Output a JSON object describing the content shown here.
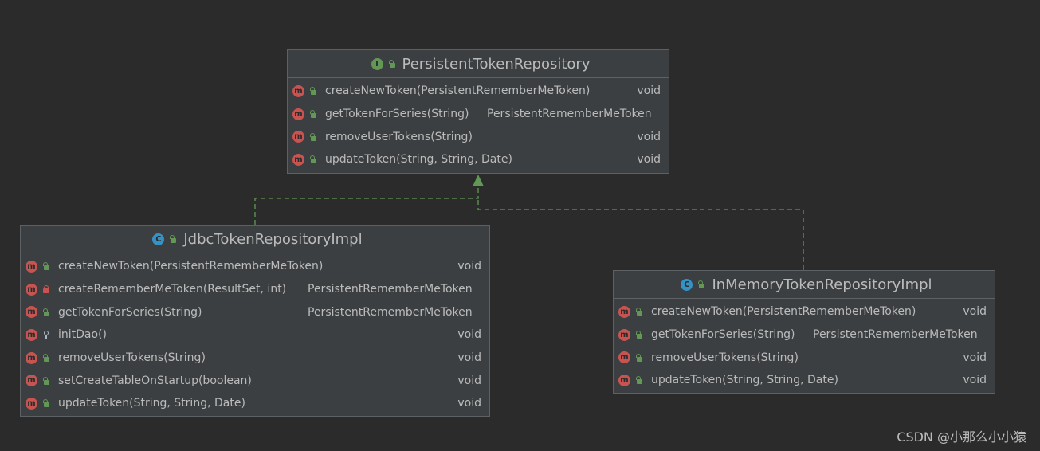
{
  "diagram": {
    "interface": {
      "kind_badge": "I",
      "name": "PersistentTokenRepository",
      "methods": [
        {
          "signature": "createNewToken(PersistentRememberMeToken)",
          "return_type": "void",
          "access": "public"
        },
        {
          "signature": "getTokenForSeries(String)",
          "return_type": "PersistentRememberMeToken",
          "access": "public"
        },
        {
          "signature": "removeUserTokens(String)",
          "return_type": "void",
          "access": "public"
        },
        {
          "signature": "updateToken(String, String, Date)",
          "return_type": "void",
          "access": "public"
        }
      ]
    },
    "jdbc_class": {
      "kind_badge": "C",
      "name": "JdbcTokenRepositoryImpl",
      "methods": [
        {
          "signature": "createNewToken(PersistentRememberMeToken)",
          "return_type": "void",
          "access": "public"
        },
        {
          "signature": "createRememberMeToken(ResultSet, int)",
          "return_type": "PersistentRememberMeToken",
          "access": "private"
        },
        {
          "signature": "getTokenForSeries(String)",
          "return_type": "PersistentRememberMeToken",
          "access": "public"
        },
        {
          "signature": "initDao()",
          "return_type": "void",
          "access": "package"
        },
        {
          "signature": "removeUserTokens(String)",
          "return_type": "void",
          "access": "public"
        },
        {
          "signature": "setCreateTableOnStartup(boolean)",
          "return_type": "void",
          "access": "public"
        },
        {
          "signature": "updateToken(String, String, Date)",
          "return_type": "void",
          "access": "public"
        }
      ]
    },
    "memory_class": {
      "kind_badge": "C",
      "name": "InMemoryTokenRepositoryImpl",
      "methods": [
        {
          "signature": "createNewToken(PersistentRememberMeToken)",
          "return_type": "void",
          "access": "public"
        },
        {
          "signature": "getTokenForSeries(String)",
          "return_type": "PersistentRememberMeToken",
          "access": "public"
        },
        {
          "signature": "removeUserTokens(String)",
          "return_type": "void",
          "access": "public"
        },
        {
          "signature": "updateToken(String, String, Date)",
          "return_type": "void",
          "access": "public"
        }
      ]
    },
    "relations": [
      {
        "from": "JdbcTokenRepositoryImpl",
        "to": "PersistentTokenRepository",
        "type": "implements"
      },
      {
        "from": "InMemoryTokenRepositoryImpl",
        "to": "PersistentTokenRepository",
        "type": "implements"
      }
    ],
    "method_badge": "m"
  },
  "colors": {
    "background": "#2b2b2b",
    "box": "#3c3f41",
    "edge": "#629755",
    "text": "#bbbbbb"
  },
  "watermark": "CSDN @小那么小小猿"
}
